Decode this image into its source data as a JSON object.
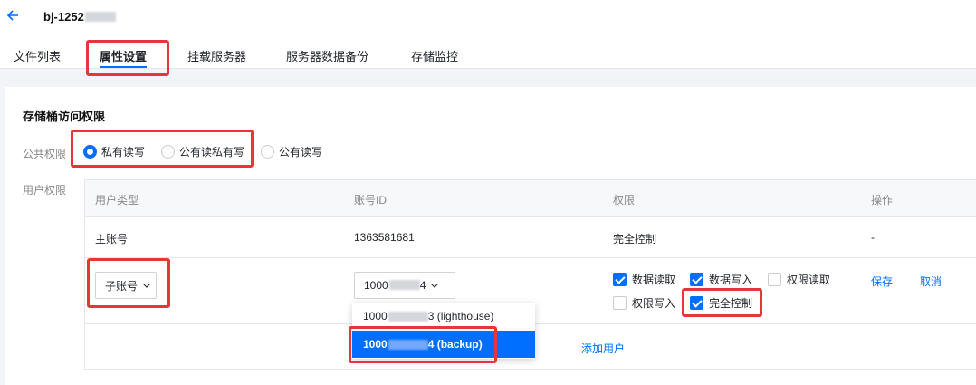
{
  "header": {
    "bucket_name_prefix": "bj-1252",
    "back_icon": "arrow-left-icon"
  },
  "tabs": [
    {
      "label": "文件列表"
    },
    {
      "label": "属性设置"
    },
    {
      "label": "挂载服务器"
    },
    {
      "label": "服务器数据备份"
    },
    {
      "label": "存储监控"
    }
  ],
  "access": {
    "section_title": "存储桶访问权限",
    "public_label": "公共权限",
    "public_options": [
      {
        "label": "私有读写",
        "selected": true
      },
      {
        "label": "公有读私有写",
        "selected": false
      },
      {
        "label": "公有读写",
        "selected": false
      }
    ],
    "user_label": "用户权限"
  },
  "table": {
    "headers": [
      "用户类型",
      "账号ID",
      "权限",
      "操作"
    ],
    "main_row": {
      "type": "主账号",
      "account_id": "1363581681",
      "permission": "完全控制",
      "action": "-"
    },
    "edit_row": {
      "type_select": "子账号",
      "account_select_prefix": "1000",
      "account_select_suffix": "4",
      "permissions": [
        {
          "label": "数据读取",
          "checked": true
        },
        {
          "label": "数据写入",
          "checked": true
        },
        {
          "label": "权限读取",
          "checked": false
        },
        {
          "label": "权限写入",
          "checked": false
        },
        {
          "label": "完全控制",
          "checked": true
        }
      ],
      "save": "保存",
      "cancel": "取消"
    },
    "add_user": "添加用户"
  },
  "dropdown": {
    "options": [
      {
        "prefix": "1000",
        "suffix": "3 (lighthouse)",
        "selected": false
      },
      {
        "prefix": "1000",
        "suffix": "4 (backup)",
        "selected": true
      }
    ]
  },
  "colors": {
    "accent": "#006eff",
    "highlight": "#e8353a"
  }
}
